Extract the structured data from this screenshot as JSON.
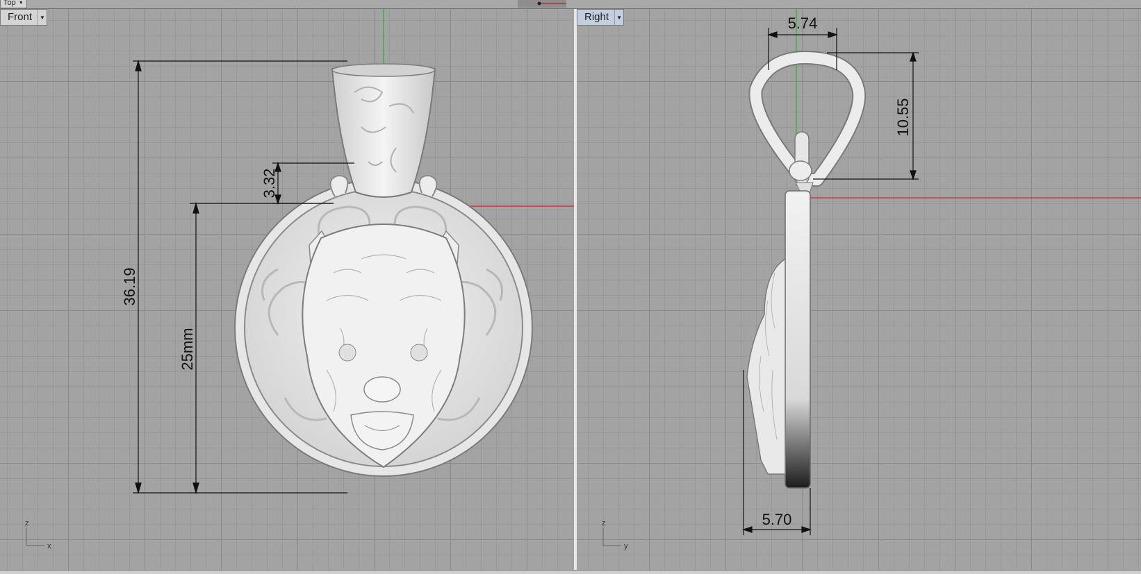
{
  "top_viewport": {
    "label": "Top",
    "dropdown_icon": "chevron-down-icon"
  },
  "front_viewport": {
    "label": "Front",
    "dropdown_icon": "chevron-down-icon",
    "axis_vertical": "z",
    "axis_horizontal": "x",
    "dimensions": {
      "overall_height": "36.19",
      "bail_gap": "3.32",
      "disc_diameter": "25mm"
    }
  },
  "right_viewport": {
    "label": "Right",
    "dropdown_icon": "chevron-down-icon",
    "axis_vertical": "z",
    "axis_horizontal": "y",
    "dimensions": {
      "bail_width": "5.74",
      "bail_height": "10.55",
      "body_thickness": "5.70"
    }
  },
  "colors": {
    "viewport_bg": "#a3a3a3",
    "grid_major": "#8a8a8a",
    "grid_minor": "#989898",
    "active_label_bg": "#c2cfe0",
    "x_axis": "#c43c3c",
    "z_axis": "#3fae48",
    "model": "#eaeaea"
  }
}
